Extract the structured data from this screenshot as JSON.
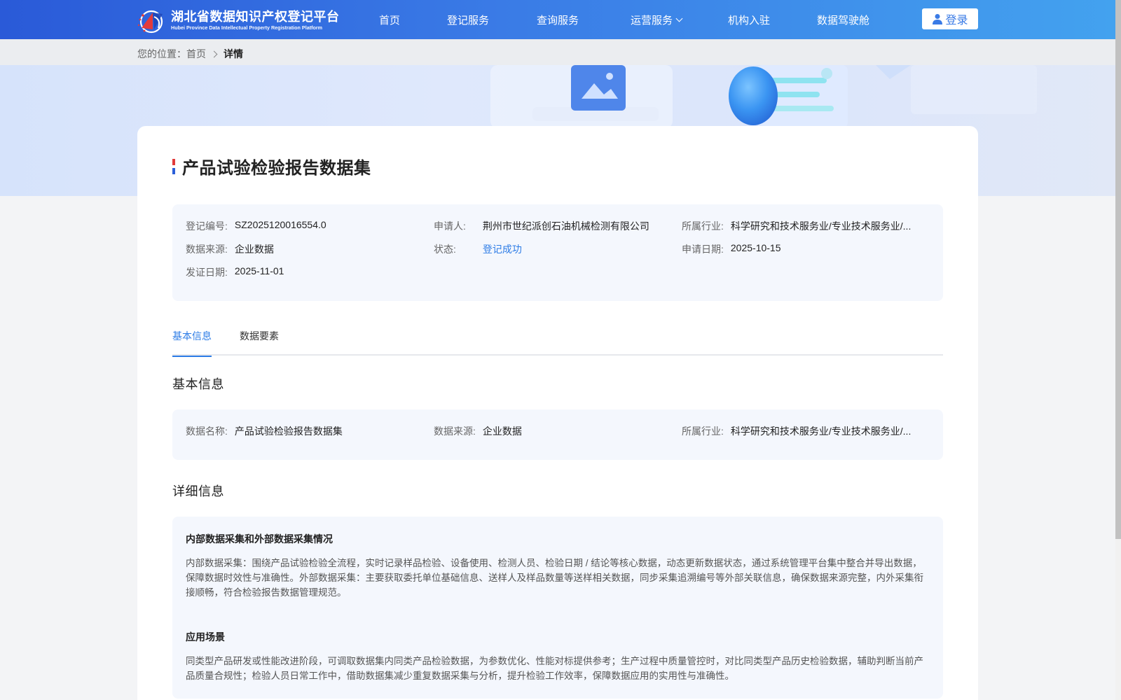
{
  "header": {
    "logo_cn": "湖北省数据知识产权登记平台",
    "logo_en": "Hubei Province Data Intellectual Property Registration Platform",
    "nav": [
      {
        "label": "首页"
      },
      {
        "label": "登记服务"
      },
      {
        "label": "查询服务"
      },
      {
        "label": "运营服务"
      },
      {
        "label": "机构入驻"
      },
      {
        "label": "数据驾驶舱"
      }
    ],
    "login_label": "登录"
  },
  "breadcrumb": {
    "prefix": "您的位置：",
    "home": "首页",
    "current": "详情"
  },
  "page": {
    "title": "产品试验检验报告数据集"
  },
  "summary": {
    "reg_no": {
      "label": "登记编号:",
      "value": "SZ2025120016554.0"
    },
    "applicant": {
      "label": "申请人:",
      "value": "荆州市世纪派创石油机械检测有限公司"
    },
    "industry": {
      "label": "所属行业:",
      "value": "科学研究和技术服务业/专业技术服务业/..."
    },
    "source": {
      "label": "数据来源:",
      "value": "企业数据"
    },
    "status": {
      "label": "状态:",
      "value": "登记成功"
    },
    "apply_date": {
      "label": "申请日期:",
      "value": "2025-10-15"
    },
    "issue_date": {
      "label": "发证日期:",
      "value": "2025-11-01"
    }
  },
  "tabs": [
    {
      "label": "基本信息"
    },
    {
      "label": "数据要素"
    }
  ],
  "basic": {
    "title": "基本信息",
    "name": {
      "label": "数据名称:",
      "value": "产品试验检验报告数据集"
    },
    "source": {
      "label": "数据来源:",
      "value": "企业数据"
    },
    "industry": {
      "label": "所属行业:",
      "value": "科学研究和技术服务业/专业技术服务业/..."
    }
  },
  "detail": {
    "title": "详细信息",
    "collection_heading": "内部数据采集和外部数据采集情况",
    "collection_text": "内部数据采集：围绕产品试验检验全流程，实时记录样品检验、设备使用、检测人员、检验日期 / 结论等核心数据，动态更新数据状态，通过系统管理平台集中整合并导出数据，保障数据时效性与准确性。外部数据采集：主要获取委托单位基础信息、送样人及样品数量等送样相关数据，同步采集追溯编号等外部关联信息，确保数据来源完整，内外采集衔接顺畅，符合检验报告数据管理规范。",
    "scenario_heading": "应用场景",
    "scenario_text": "同类型产品研发或性能改进阶段，可调取数据集内同类产品检验数据，为参数优化、性能对标提供参考；生产过程中质量管控时，对比同类型产品历史检验数据，辅助判断当前产品质量合规性；检验人员日常工作中，借助数据集减少重复数据采集与分析，提升检验工作效率，保障数据应用的实用性与准确性。"
  }
}
